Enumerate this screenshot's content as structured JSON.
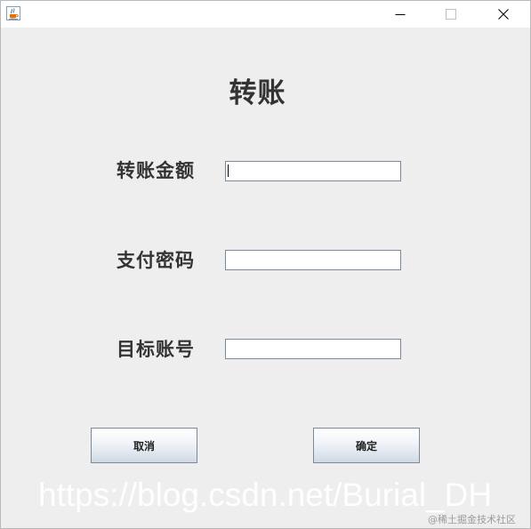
{
  "window": {
    "title_bar": {
      "icons": [
        "java-coffee-icon",
        "minimize-icon",
        "maximize-icon",
        "close-icon"
      ]
    }
  },
  "form": {
    "title": "转账",
    "fields": [
      {
        "label": "转账金额",
        "value": ""
      },
      {
        "label": "支付密码",
        "value": ""
      },
      {
        "label": "目标账号",
        "value": ""
      }
    ]
  },
  "buttons": {
    "cancel_label": "取消",
    "ok_label": "确定"
  },
  "overlay": {
    "watermark": "https://blog.csdn.net/Burial_DH",
    "credit": "@稀土掘金技术社区"
  },
  "colors": {
    "window_background": "#eeeeee",
    "titlebar_background": "#ffffff",
    "text": "#333333",
    "input_border": "#7a8a99"
  }
}
